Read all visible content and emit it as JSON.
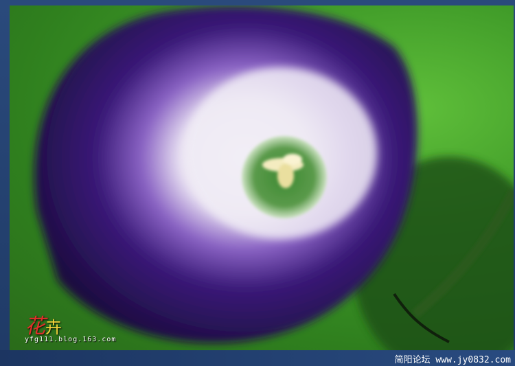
{
  "photo": {
    "signature_char1": "花",
    "signature_char2": "卉",
    "signature_url": "yfg111.blog.163.com",
    "subject_icon": "morning-glory-flower-icon"
  },
  "watermark": {
    "forum_name": "简阳论坛",
    "forum_url": "www.jy0832.com"
  },
  "colors": {
    "petal_purple": "#3a1a78",
    "throat_white": "#f0ecf5",
    "center_green": "#4f8f3a",
    "background_green": "#3f9a28",
    "frame_blue": "#24406e"
  }
}
